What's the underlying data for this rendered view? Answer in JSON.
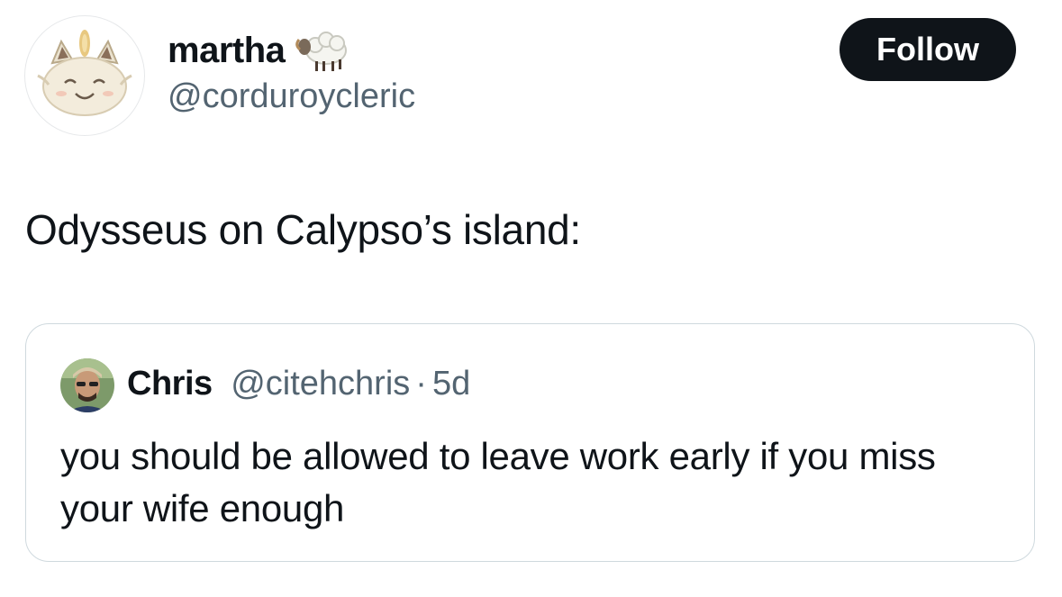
{
  "tweet": {
    "author": {
      "display_name": "martha",
      "name_emoji": "sheep-icon",
      "handle": "@corduroycleric",
      "avatar": "meowth-plush-avatar"
    },
    "follow_label": "Follow",
    "text": "Odysseus on Calypso’s island:"
  },
  "quoted_tweet": {
    "author": {
      "display_name": "Chris",
      "handle": "@citehchris",
      "avatar": "chris-avatar"
    },
    "separator": "·",
    "time": "5d",
    "text": "you should be allowed to leave work early if you miss your wife enough"
  },
  "colors": {
    "text_primary": "#0f1419",
    "text_secondary": "#536471",
    "border": "#cfd9de",
    "button_bg": "#0f1419"
  }
}
